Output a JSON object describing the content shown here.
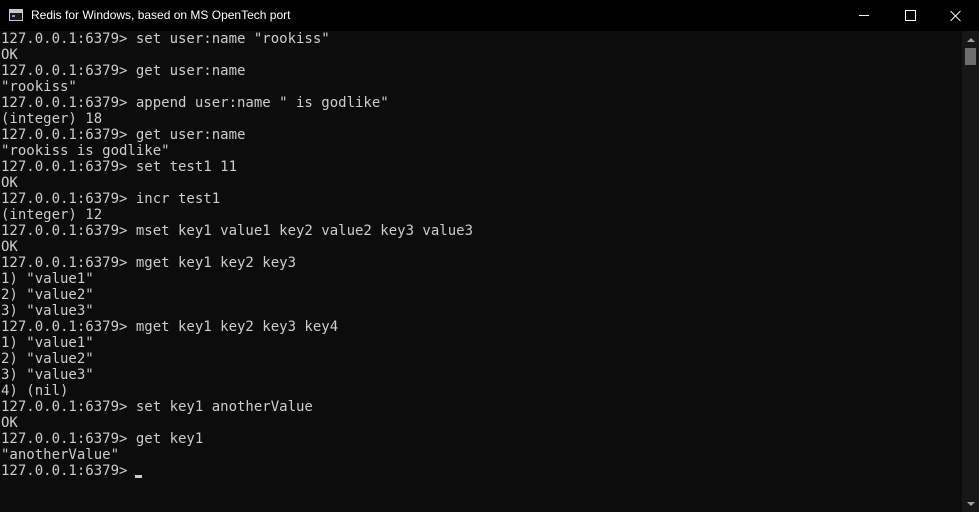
{
  "window": {
    "title": "Redis for Windows, based on MS OpenTech port"
  },
  "console": {
    "lines": [
      "127.0.0.1:6379> set user:name \"rookiss\"",
      "OK",
      "127.0.0.1:6379> get user:name",
      "\"rookiss\"",
      "127.0.0.1:6379> append user:name \" is godlike\"",
      "(integer) 18",
      "127.0.0.1:6379> get user:name",
      "\"rookiss is godlike\"",
      "127.0.0.1:6379> set test1 11",
      "OK",
      "127.0.0.1:6379> incr test1",
      "(integer) 12",
      "127.0.0.1:6379> mset key1 value1 key2 value2 key3 value3",
      "OK",
      "127.0.0.1:6379> mget key1 key2 key3",
      "1) \"value1\"",
      "2) \"value2\"",
      "3) \"value3\"",
      "127.0.0.1:6379> mget key1 key2 key3 key4",
      "1) \"value1\"",
      "2) \"value2\"",
      "3) \"value3\"",
      "4) (nil)",
      "127.0.0.1:6379> set key1 anotherValue",
      "OK",
      "127.0.0.1:6379> get key1",
      "\"anotherValue\""
    ],
    "current_prompt": "127.0.0.1:6379>"
  },
  "colors": {
    "background": "#0c0c0c",
    "text": "#cccccc",
    "titlebar": "#000000"
  },
  "icons": {
    "app": "console-window-icon",
    "minimize": "minimize-icon",
    "maximize": "maximize-icon",
    "close": "close-icon"
  }
}
